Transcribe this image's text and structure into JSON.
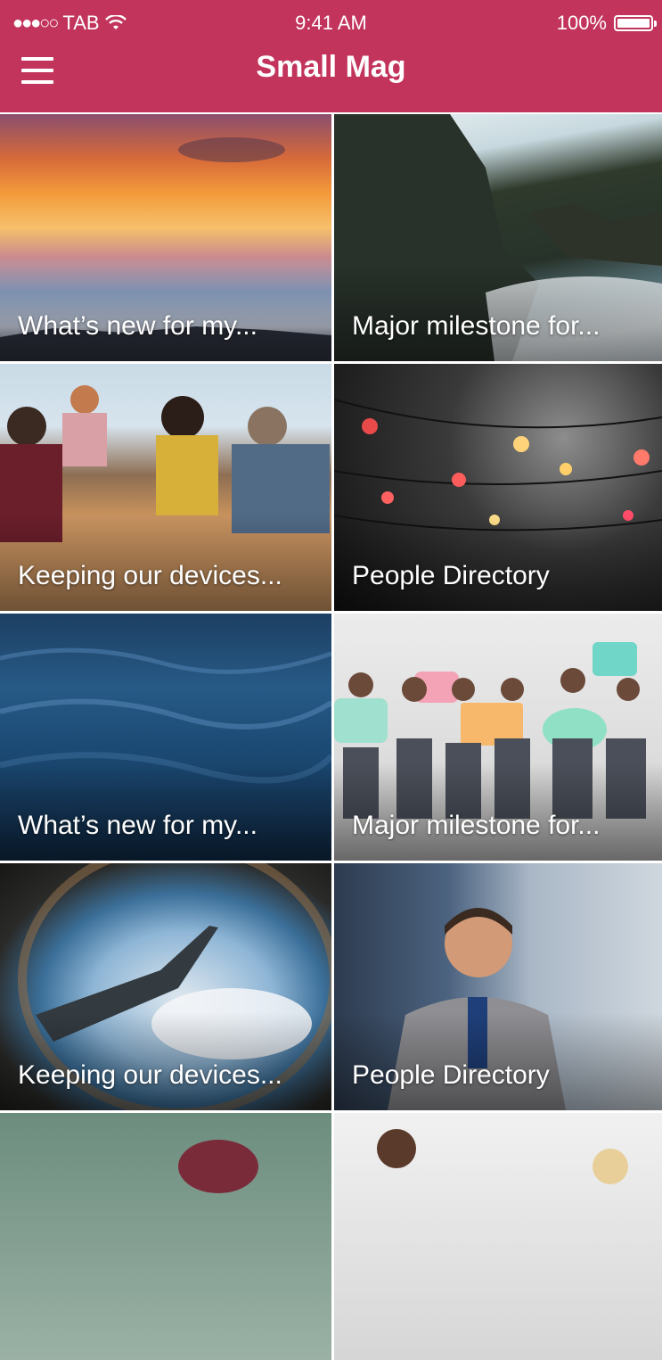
{
  "status_bar": {
    "carrier": "TAB",
    "time": "9:41 AM",
    "battery": "100%"
  },
  "header": {
    "title": "Small Mag",
    "menu_icon": "hamburger-menu-icon"
  },
  "tiles": [
    {
      "caption": "What’s new for my..."
    },
    {
      "caption": "Major milestone for..."
    },
    {
      "caption": "Keeping our devices..."
    },
    {
      "caption": "People Directory"
    },
    {
      "caption": "What’s new for my..."
    },
    {
      "caption": "Major milestone for..."
    },
    {
      "caption": "Keeping our devices..."
    },
    {
      "caption": "People Directory"
    },
    {
      "caption": ""
    },
    {
      "caption": ""
    }
  ]
}
